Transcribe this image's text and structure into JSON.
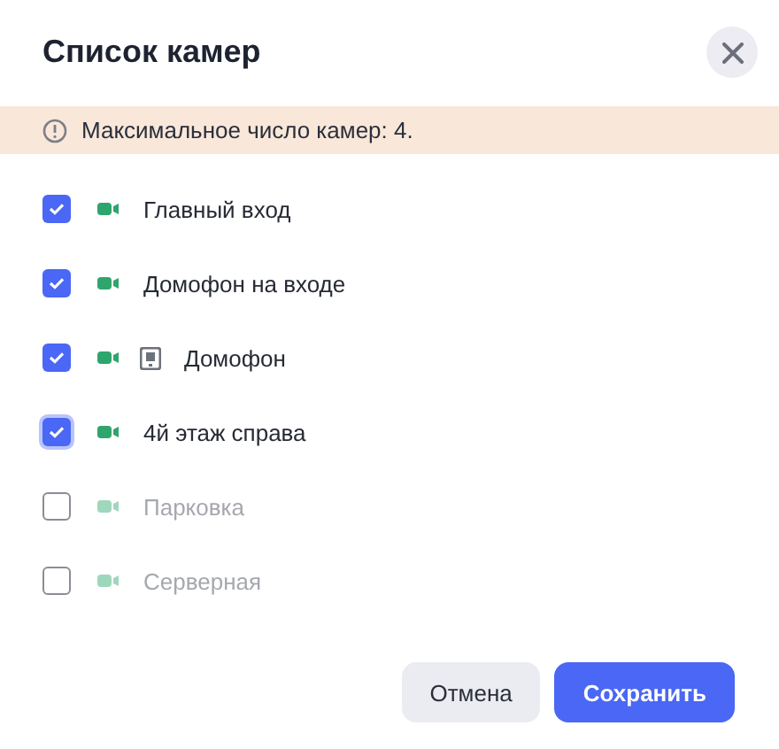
{
  "dialog": {
    "title": "Список камер"
  },
  "notice": {
    "text": "Максимальное число камер: 4."
  },
  "cameras": [
    {
      "name": "Главный вход",
      "checked": true,
      "disabled": false,
      "focused": false,
      "intercom": false
    },
    {
      "name": "Домофон на входе",
      "checked": true,
      "disabled": false,
      "focused": false,
      "intercom": false
    },
    {
      "name": "Домофон",
      "checked": true,
      "disabled": false,
      "focused": false,
      "intercom": true
    },
    {
      "name": "4й этаж справа",
      "checked": true,
      "disabled": false,
      "focused": true,
      "intercom": false
    },
    {
      "name": "Парковка",
      "checked": false,
      "disabled": true,
      "focused": false,
      "intercom": false
    },
    {
      "name": "Серверная",
      "checked": false,
      "disabled": true,
      "focused": false,
      "intercom": false
    }
  ],
  "buttons": [
    {
      "label": "Отмена",
      "kind": "secondary"
    },
    {
      "label": "Сохранить",
      "kind": "primary"
    }
  ]
}
